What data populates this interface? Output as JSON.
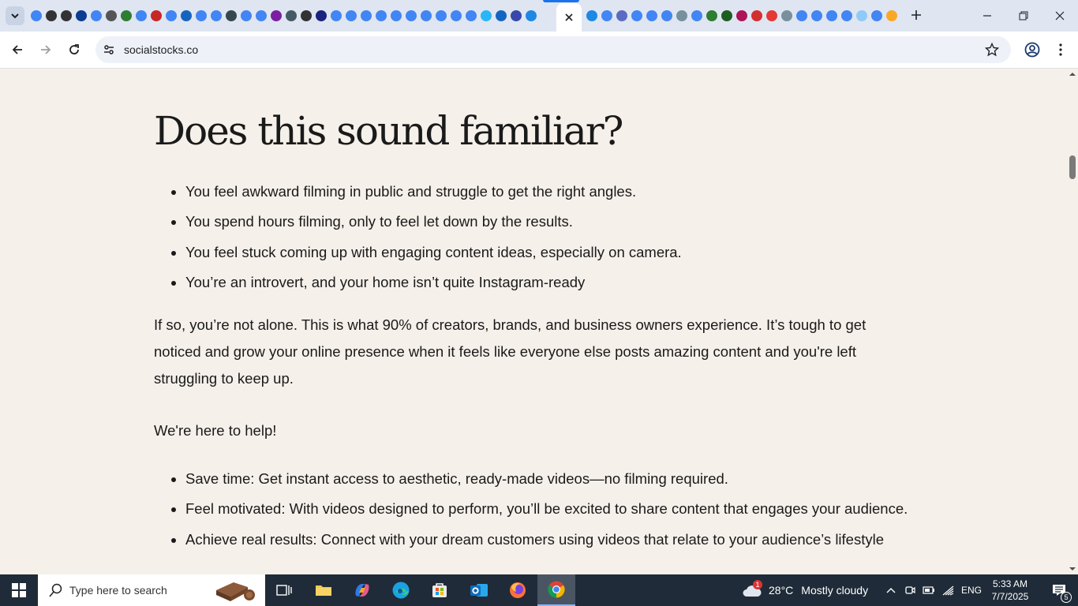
{
  "browser": {
    "url": "socialstocks.co",
    "tab_favicon_colors": [
      "#4285f4",
      "#333333",
      "#333333",
      "#0b3d91",
      "#4285f4",
      "#555555",
      "#2e7d32",
      "#4285f4",
      "#c62828",
      "#4285f4",
      "#1565c0",
      "#4285f4",
      "#4285f4",
      "#37474f",
      "#4285f4",
      "#4285f4",
      "#7b1fa2",
      "#455a64",
      "#333333",
      "#1a237e",
      "#4285f4",
      "#4285f4",
      "#4285f4",
      "#4285f4",
      "#4285f4",
      "#4285f4",
      "#4285f4",
      "#4285f4",
      "#4285f4",
      "#4285f4",
      "#29b6f6",
      "#1565c0",
      "#3949ab",
      "#1e88e5"
    ],
    "tab_favicon_colors_right": [
      "#1e88e5",
      "#4285f4",
      "#5c6bc0",
      "#4285f4",
      "#4285f4",
      "#4285f4",
      "#78909c",
      "#4285f4",
      "#2e7d32",
      "#1b5e20",
      "#ad1457",
      "#d32f2f",
      "#e53935",
      "#78909c",
      "#4285f4",
      "#4285f4",
      "#4285f4",
      "#4285f4",
      "#90caf9",
      "#4285f4",
      "#f9a825"
    ],
    "icons": {
      "tab_search": "chevron-down-icon",
      "close_tab": "close-icon",
      "new_tab": "plus-icon",
      "back": "arrow-left-icon",
      "forward": "arrow-right-icon",
      "reload": "reload-icon",
      "site_info": "tune-icon",
      "bookmark": "star-icon",
      "profile": "profile-icon",
      "menu": "kebab-icon"
    }
  },
  "page": {
    "title": "Does this sound familiar?",
    "pain_points": [
      "You feel awkward filming in public and struggle to get the right angles.",
      "You spend hours filming, only to feel let down by the results.",
      "You feel stuck coming up with engaging content ideas, especially on camera.",
      "You’re an introvert, and your home isn’t quite Instagram-ready"
    ],
    "paragraph": "If so, you’re not alone. This is what 90% of creators, brands, and business owners experience. It’s tough to get noticed and grow your online presence when it feels like everyone else posts amazing content and you're left struggling to keep up.",
    "help_heading": "We're here to help!",
    "benefits": [
      "Save time: Get instant access to aesthetic, ready-made videos—no filming required.",
      "Feel motivated: With videos designed to perform, you’ll be excited to share content that engages your audience.",
      "Achieve real results: Connect with your dream customers using videos that relate to your audience’s lifestyle"
    ]
  },
  "taskbar": {
    "search_placeholder": "Type here to search",
    "weather_temp": "28°C",
    "weather_desc": "Mostly cloudy",
    "weather_badge": "1",
    "language": "ENG",
    "time": "5:33 AM",
    "date": "7/7/2025",
    "notification_count": "5"
  },
  "colors": {
    "page_bg": "#f5f0ea",
    "text": "#1a1a1a",
    "tabstrip_bg": "#dfe6f2",
    "taskbar_bg": "#1f2b38",
    "accent": "#1a73e8"
  }
}
